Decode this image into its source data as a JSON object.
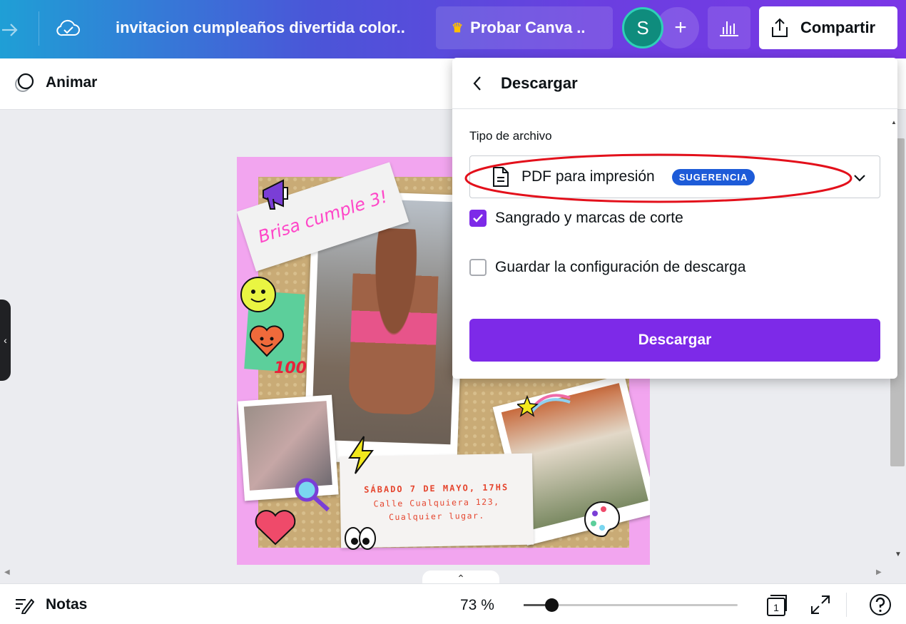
{
  "header": {
    "doc_title": "invitacion cumpleaños divertida color..",
    "try_label": "Probar Canva ..",
    "avatar_initial": "S",
    "plus_label": "+",
    "share_label": "Compartir"
  },
  "toolbar": {
    "animate_label": "Animar"
  },
  "design": {
    "title": "Brisa cumple 3!",
    "date": "SÁBADO 7 DE MAYO, 17HS",
    "address_line1": "Calle Cualquiera 123,",
    "address_line2": "Cualquier lugar.",
    "sticker_100": "100"
  },
  "download_panel": {
    "title": "Descargar",
    "file_type_label": "Tipo de archivo",
    "file_type_value": "PDF para impresión",
    "suggestion_badge": "SUGERENCIA",
    "bleed_label": "Sangrado y marcas de corte",
    "bleed_checked": true,
    "save_settings_label": "Guardar la configuración de descarga",
    "save_settings_checked": false,
    "download_button": "Descargar",
    "highlight_color": "#e3101b"
  },
  "footer": {
    "notes_label": "Notas",
    "zoom_label": "73 %",
    "zoom_fraction": 0.13,
    "page_count": "1"
  },
  "colors": {
    "accent": "#7d2ae8",
    "badge": "#1d5bd8",
    "avatar": "#0f8c7d"
  }
}
